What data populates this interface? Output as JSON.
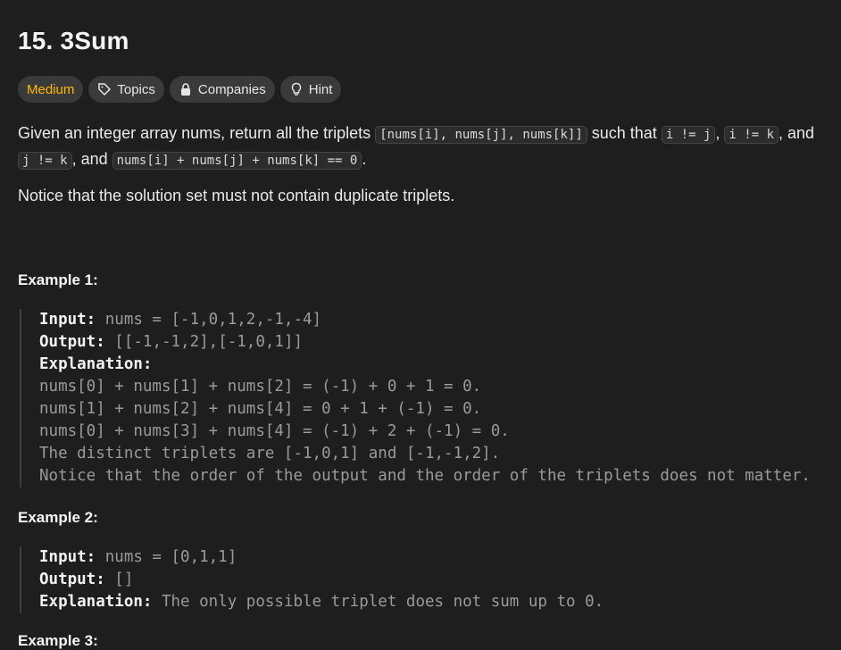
{
  "problem": {
    "title": "15. 3Sum",
    "tags": {
      "difficulty": "Medium",
      "topics": "Topics",
      "companies": "Companies",
      "hint": "Hint"
    },
    "desc": {
      "p1a": "Given an integer array nums, return all the triplets ",
      "c1": "[nums[i], nums[j], nums[k]]",
      "p1b": " such that ",
      "c2": "i != j",
      "p1c": ", ",
      "c3": "i != k",
      "p1d": ", and ",
      "c4": "j != k",
      "p1e": ", and ",
      "c5": "nums[i] + nums[j] + nums[k] == 0",
      "p1f": "."
    },
    "notice": "Notice that the solution set must not contain duplicate triplets."
  },
  "example1": {
    "title": "Example 1:",
    "input_label": "Input:",
    "input_value": " nums = [-1,0,1,2,-1,-4]",
    "output_label": "Output:",
    "output_value": " [[-1,-1,2],[-1,0,1]]",
    "explanation_label": "Explanation:",
    "lines": [
      "nums[0] + nums[1] + nums[2] = (-1) + 0 + 1 = 0.",
      "nums[1] + nums[2] + nums[4] = 0 + 1 + (-1) = 0.",
      "nums[0] + nums[3] + nums[4] = (-1) + 2 + (-1) = 0.",
      "The distinct triplets are [-1,0,1] and [-1,-1,2].",
      "Notice that the order of the output and the order of the triplets does not matter."
    ]
  },
  "example2": {
    "title": "Example 2:",
    "input_label": "Input:",
    "input_value": " nums = [0,1,1]",
    "output_label": "Output:",
    "output_value": " []",
    "explanation_label": "Explanation:",
    "explanation_value": " The only possible triplet does not sum up to 0."
  },
  "example3": {
    "title": "Example 3:"
  },
  "colors": {
    "background": "#1e1e1e",
    "difficulty_medium": "#ffb800",
    "tag_bg": "#3a3a3a"
  }
}
